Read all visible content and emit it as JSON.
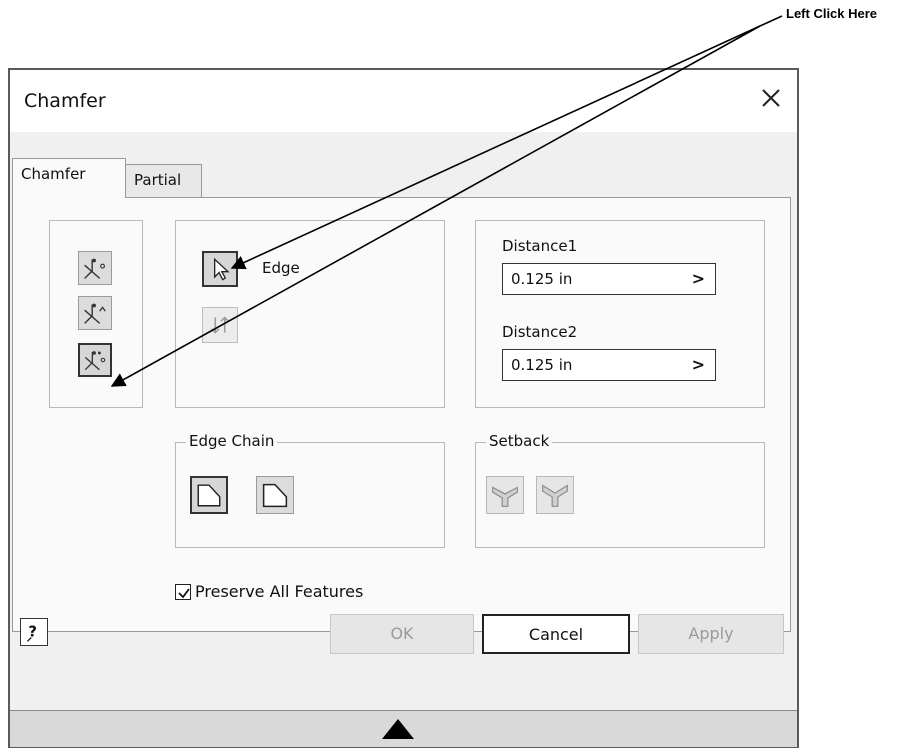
{
  "annotation": {
    "label": "Left Click Here"
  },
  "dialog": {
    "title": "Chamfer",
    "close_icon": "close-icon",
    "tabs": [
      {
        "label": "Chamfer",
        "active": true
      },
      {
        "label": "Partial",
        "active": false
      }
    ]
  },
  "methods": [
    {
      "icon": "chamfer-distance-icon",
      "selected": false
    },
    {
      "icon": "chamfer-distance-angle-icon",
      "selected": false
    },
    {
      "icon": "chamfer-two-distances-icon",
      "selected": true
    }
  ],
  "edge_panel": {
    "edge_label": "Edge",
    "edge_icon": "cursor-select-icon",
    "flip_icon": "flip-direction-icon"
  },
  "distances": {
    "distance1_label": "Distance1",
    "distance1_value": "0.125 in",
    "distance2_label": "Distance2",
    "distance2_value": "0.125 in",
    "arrow_glyph": ">"
  },
  "edge_chain": {
    "title": "Edge Chain",
    "icons": [
      "all-edges-chain-icon",
      "single-edge-chain-icon"
    ]
  },
  "setback": {
    "title": "Setback",
    "icons": [
      "setback-icon",
      "no-setback-icon"
    ]
  },
  "preserve": {
    "label": "Preserve All Features",
    "checked": true
  },
  "footer": {
    "help_glyph": "?",
    "ok_label": "OK",
    "cancel_label": "Cancel",
    "apply_label": "Apply"
  },
  "colors": {
    "accent": "#333333",
    "disabled_text": "#9a9a9a"
  }
}
